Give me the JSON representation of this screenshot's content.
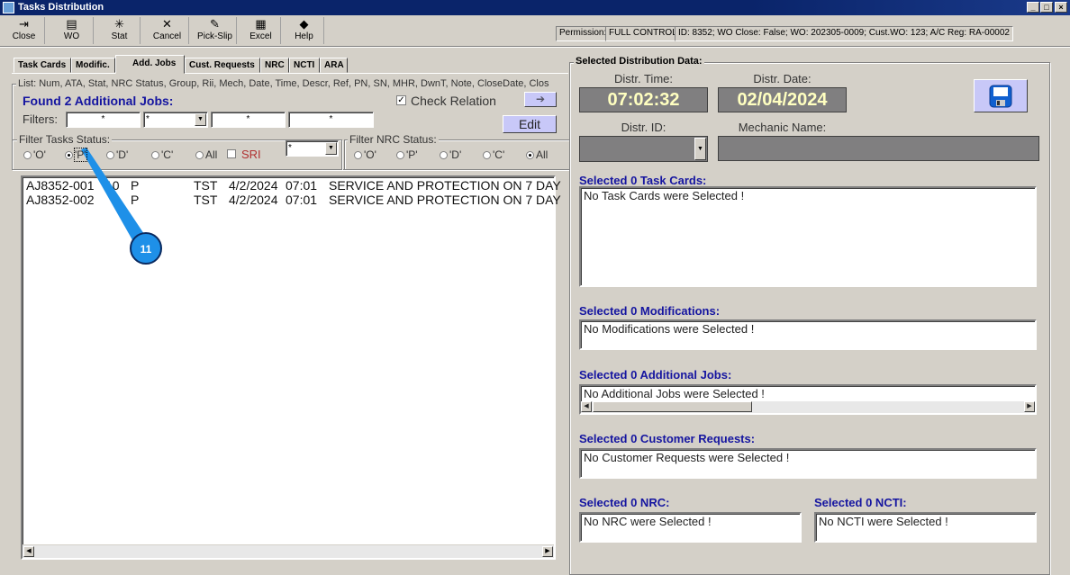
{
  "window": {
    "title": "Tasks Distribution",
    "min": "_",
    "max": "□",
    "close": "×"
  },
  "toolbar": [
    {
      "label": "Close",
      "icon": "⇥"
    },
    {
      "label": "WO",
      "icon": "▤"
    },
    {
      "label": "Stat",
      "icon": "✳"
    },
    {
      "label": "Cancel",
      "icon": "✕"
    },
    {
      "label": "Pick-Slip",
      "icon": "✎"
    },
    {
      "label": "Excel",
      "icon": "▦"
    },
    {
      "label": "Help",
      "icon": "◆"
    }
  ],
  "status": {
    "permission_label": "Permission:",
    "permission_value": "FULL CONTROL",
    "info": "ID: 8352; WO Close: False; WO: 202305-0009; Cust.WO: 123; A/C Reg: RA-00002"
  },
  "tabs": [
    "Task Cards",
    "Modific.",
    "Add. Jobs",
    "Cust. Requests",
    "NRC",
    "NCTI",
    "ARA"
  ],
  "left": {
    "list_legend": "List: Num, ATA, Stat, NRC Status, Group, Rii, Mech, Date, Time, Descr, Ref, PN, SN, MHR, DwnT, Note, CloseDate, Clos",
    "found": "Found 2 Additional Jobs:",
    "check_relation": "Check Relation",
    "filters_label": "Filters:",
    "filter_values": [
      "*",
      "*",
      "*",
      "*"
    ],
    "edit": "Edit",
    "arrow": "➔",
    "task_status_legend": "Filter Tasks Status:",
    "task_status": [
      "'O'",
      "'P'",
      "'D'",
      "'C'",
      "All"
    ],
    "sri": "SRI",
    "status_combo": "*",
    "nrc_status_legend": "Filter NRC Status:",
    "nrc_status": [
      "'O'",
      "'P'",
      "'D'",
      "'C'",
      "All"
    ],
    "rows": [
      [
        "AJ8352-001",
        "10",
        "P",
        "TST",
        "4/2/2024",
        "07:01",
        "SERVICE AND PROTECTION ON 7 DAY"
      ],
      [
        "AJ8352-002",
        "",
        "P",
        "TST",
        "4/2/2024",
        "07:01",
        "SERVICE AND PROTECTION ON 7 DAY"
      ]
    ]
  },
  "right": {
    "legend": "Selected Distribution Data:",
    "time_label": "Distr. Time:",
    "time": "07:02:32",
    "date_label": "Distr. Date:",
    "date": "02/04/2024",
    "id_label": "Distr. ID:",
    "mech_label": "Mechanic Name:",
    "task_cards_title": "Selected 0 Task Cards:",
    "task_cards": "No Task Cards were Selected !",
    "mods_title": "Selected 0 Modifications:",
    "mods": "No Modifications were Selected !",
    "addjobs_title": "Selected 0 Additional Jobs:",
    "addjobs": "No Additional Jobs were Selected !",
    "custreq_title": "Selected 0 Customer Requests:",
    "custreq": "No Customer Requests were Selected !",
    "nrc_title": "Selected 0 NRC:",
    "nrc": "No NRC were Selected !",
    "ncti_title": "Selected 0 NCTI:",
    "ncti": "No NCTI were Selected !"
  },
  "annotation": {
    "number": "11",
    "color": "#1e90e8"
  }
}
